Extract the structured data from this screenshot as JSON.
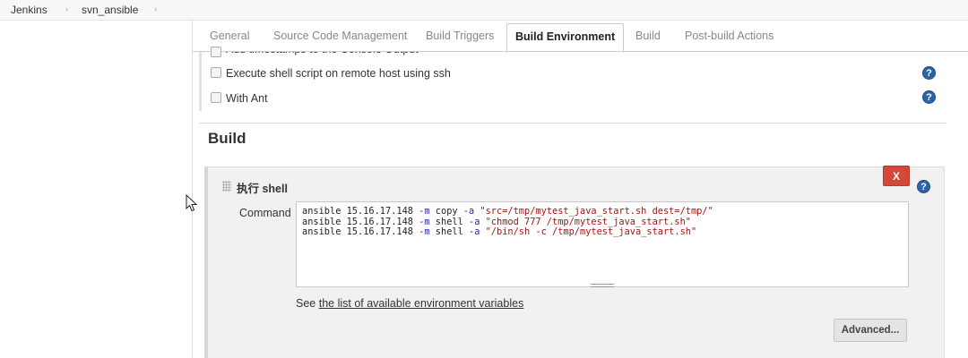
{
  "breadcrumb": {
    "items": [
      "Jenkins",
      "svn_ansible"
    ],
    "separator": "›"
  },
  "tabs": [
    {
      "label": "General",
      "active": false
    },
    {
      "label": "Source Code Management",
      "active": false
    },
    {
      "label": "Build Triggers",
      "active": false
    },
    {
      "label": "Build Environment",
      "active": true
    },
    {
      "label": "Build",
      "active": false
    },
    {
      "label": "Post-build Actions",
      "active": false
    }
  ],
  "build_environment": {
    "options": [
      {
        "label": "Add timestamps to the Console Output",
        "checked": false,
        "partially_visible": true
      },
      {
        "label": "Execute shell script on remote host using ssh",
        "checked": false
      },
      {
        "label": "With Ant",
        "checked": false
      }
    ]
  },
  "build": {
    "heading": "Build",
    "step": {
      "title": "执行 shell",
      "delete_label": "X",
      "command_label": "Command",
      "command_lines": [
        "ansible 15.16.17.148 -m copy -a \"src=/tmp/mytest_java_start.sh dest=/tmp/\"",
        "ansible 15.16.17.148 -m shell -a \"chmod 777 /tmp/mytest_java_start.sh\"",
        "ansible 15.16.17.148 -m shell -a \"/bin/sh -c /tmp/mytest_java_start.sh\""
      ],
      "env_vars_prefix": "See ",
      "env_vars_link": "the list of available environment variables",
      "advanced_label": "Advanced..."
    }
  },
  "help_icon_glyph": "?",
  "colors": {
    "help_icon": "#2c64a8",
    "delete_button": "#d24939"
  }
}
